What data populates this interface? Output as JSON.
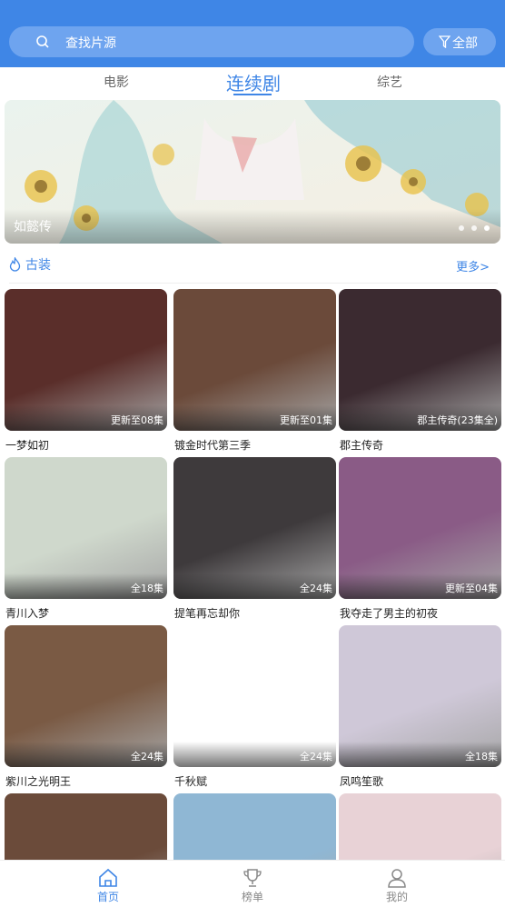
{
  "search": {
    "placeholder": "查找片源"
  },
  "filter": {
    "label": "全部"
  },
  "tabs": [
    {
      "label": "电影",
      "active": false
    },
    {
      "label": "连续剧",
      "active": true
    },
    {
      "label": "综艺",
      "active": false
    }
  ],
  "banner": {
    "title": "如懿传",
    "dots": 3,
    "active_dot": 3
  },
  "section": {
    "name": "古装",
    "more": "更多>"
  },
  "items": [
    {
      "title": "一梦如初",
      "badge": "更新至08集",
      "color": "#5a2e2a"
    },
    {
      "title": "镀金时代第三季",
      "badge": "更新至01集",
      "color": "#6b4a3a"
    },
    {
      "title": "郡主传奇",
      "badge": "郡主传奇(23集全)",
      "color": "#3b2a30"
    },
    {
      "title": "青川入梦",
      "badge": "全18集",
      "color": "#cfd8cc"
    },
    {
      "title": "提笔再忘却你",
      "badge": "全24集",
      "color": "#3e3a3c"
    },
    {
      "title": "我夺走了男主的初夜",
      "badge": "更新至04集",
      "color": "#8a5b86"
    },
    {
      "title": "紫川之光明王",
      "badge": "全24集",
      "color": "#7a5a44"
    },
    {
      "title": "千秋赋",
      "badge": "全24集",
      "color": "#ffffff"
    },
    {
      "title": "凤鸣笙歌",
      "badge": "全18集",
      "color": "#cfc8d8"
    },
    {
      "title": "",
      "badge": "",
      "color": "#6b4b3a"
    },
    {
      "title": "",
      "badge": "",
      "color": "#8fb7d4"
    },
    {
      "title": "",
      "badge": "",
      "color": "#e8d2d6"
    }
  ],
  "nav": [
    {
      "label": "首页",
      "icon": "home-icon",
      "active": true
    },
    {
      "label": "榜单",
      "icon": "trophy-icon",
      "active": false
    },
    {
      "label": "我的",
      "icon": "user-icon",
      "active": false
    }
  ],
  "colors": {
    "accent": "#3f86e6",
    "header": "#3f86e6"
  }
}
